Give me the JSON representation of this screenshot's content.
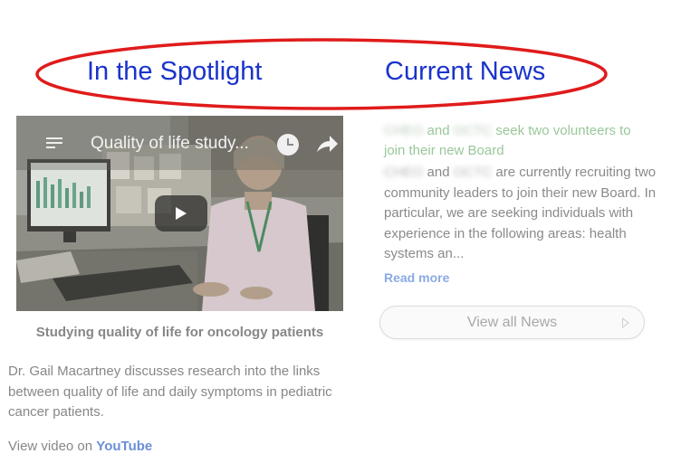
{
  "annotation": {
    "color": "#e01b1b",
    "shape": "ellipse"
  },
  "headings": {
    "spotlight": "In the Spotlight",
    "current_news": "Current News",
    "color": "#1a33cc"
  },
  "spotlight": {
    "video": {
      "title": "Quality of life study...",
      "icons": [
        "playlist-icon",
        "watch-later-icon",
        "share-icon",
        "play-icon"
      ]
    },
    "caption": "Studying quality of life for oncology patients",
    "description": "Dr. Gail Macartney discusses research into the links between quality of life and daily symptoms in pediatric cancer patients.",
    "view_prefix": "View video on ",
    "view_link": "YouTube"
  },
  "news": {
    "org1": "CHEO",
    "org2": "OCTC",
    "title_and": " and ",
    "title_rest": " seek two volunteers to join their new Board",
    "body_and": " and ",
    "body_rest": " are currently recruiting two community leaders to join their new Board. In particular, we are seeking individuals with experience in the following areas: health systems an...",
    "read_more": "Read more",
    "view_all": "View all News"
  }
}
